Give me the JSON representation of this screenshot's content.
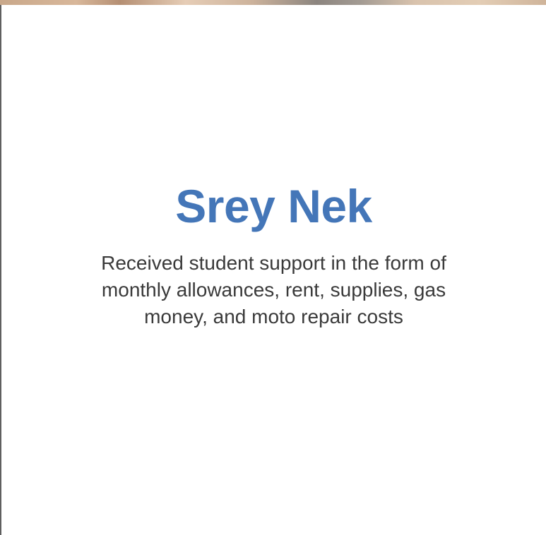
{
  "profile": {
    "name": "Srey Nek",
    "description": "Received student support in the form of monthly allowances, rent, supplies, gas money, and moto repair costs"
  },
  "colors": {
    "name_text": "#4476b8",
    "body_text": "#3a3a3a",
    "background": "#ffffff"
  }
}
